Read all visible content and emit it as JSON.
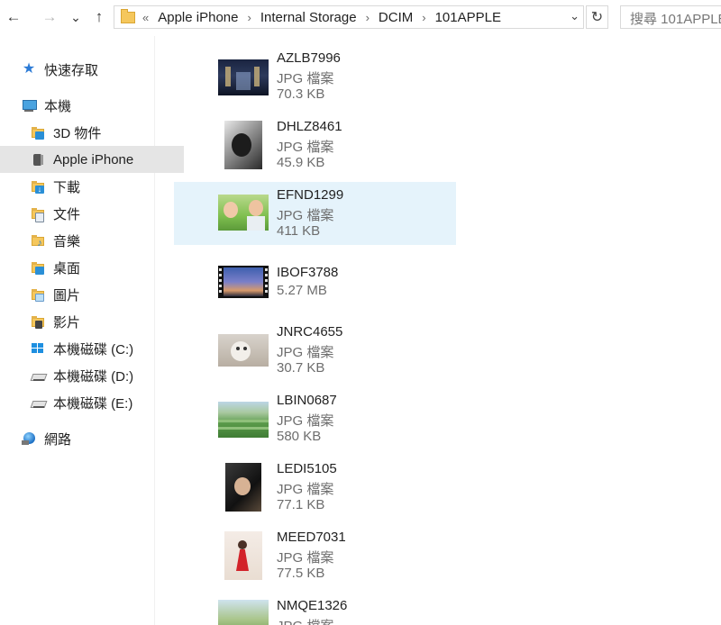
{
  "nav": {
    "back": "←",
    "forward": "→",
    "recent": "⌄",
    "up": "↑"
  },
  "address": {
    "overflow": "«",
    "crumbs": [
      "Apple iPhone",
      "Internal Storage",
      "DCIM",
      "101APPLE"
    ],
    "separator": "›",
    "dropdown": "⌄",
    "refresh": "↻"
  },
  "search": {
    "placeholder": "搜尋 101APPLE"
  },
  "sidebar": {
    "quick_access": "快速存取",
    "this_pc": "本機",
    "items": [
      {
        "label": "3D 物件"
      },
      {
        "label": "Apple iPhone"
      },
      {
        "label": "下載"
      },
      {
        "label": "文件"
      },
      {
        "label": "音樂"
      },
      {
        "label": "桌面"
      },
      {
        "label": "圖片"
      },
      {
        "label": "影片"
      },
      {
        "label": "本機磁碟 (C:)"
      },
      {
        "label": "本機磁碟 (D:)"
      },
      {
        "label": "本機磁碟 (E:)"
      }
    ],
    "network": "網路"
  },
  "files": [
    {
      "name": "AZLB7996",
      "type": "JPG 檔案",
      "size": "70.3 KB",
      "thumb": "night-street"
    },
    {
      "name": "DHLZ8461",
      "type": "JPG 檔案",
      "size": "45.9 KB",
      "thumb": "bw-portrait"
    },
    {
      "name": "EFND1299",
      "type": "JPG 檔案",
      "size": "411 KB",
      "thumb": "couple-selfie",
      "selected": true
    },
    {
      "name": "IBOF3788",
      "type": "",
      "size": "5.27 MB",
      "thumb": "video-sunset"
    },
    {
      "name": "JNRC4655",
      "type": "JPG 檔案",
      "size": "30.7 KB",
      "thumb": "cat"
    },
    {
      "name": "LBIN0687",
      "type": "JPG 檔案",
      "size": "580 KB",
      "thumb": "terraces"
    },
    {
      "name": "LEDI5105",
      "type": "JPG 檔案",
      "size": "77.1 KB",
      "thumb": "dark-portrait"
    },
    {
      "name": "MEED7031",
      "type": "JPG 檔案",
      "size": "77.5 KB",
      "thumb": "red-dress"
    },
    {
      "name": "NMQE1326",
      "type": "JPG 檔案",
      "size": "",
      "thumb": "outdoor"
    }
  ]
}
